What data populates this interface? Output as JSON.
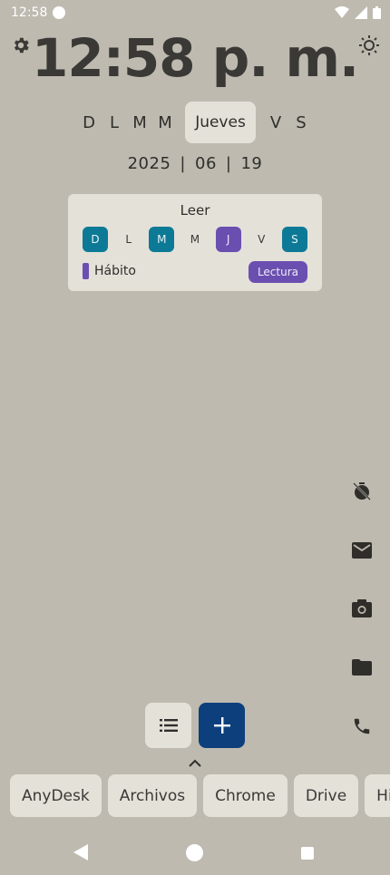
{
  "status_bar": {
    "time": "12:58"
  },
  "clock": "12:58 p. m.",
  "weekdays": {
    "before": [
      "D",
      "L",
      "M",
      "M"
    ],
    "selected": "Jueves",
    "after": [
      "V",
      "S"
    ]
  },
  "date": {
    "year": "2025",
    "month": "06",
    "day": "19",
    "separator": "|"
  },
  "habit_card": {
    "title": "Leer",
    "days": [
      {
        "label": "D",
        "state": "blue"
      },
      {
        "label": "L",
        "state": "none"
      },
      {
        "label": "M",
        "state": "blue"
      },
      {
        "label": "M",
        "state": "none"
      },
      {
        "label": "J",
        "state": "purple"
      },
      {
        "label": "V",
        "state": "none"
      },
      {
        "label": "S",
        "state": "blue"
      }
    ],
    "type_label": "Hábito",
    "tag": "Lectura"
  },
  "side_icons": [
    "timer-off-icon",
    "mail-icon",
    "camera-icon",
    "folder-icon",
    "phone-icon"
  ],
  "apps": [
    "AnyDesk",
    "Archivos",
    "Chrome",
    "Drive",
    "HiP"
  ],
  "colors": {
    "background": "#bebab0",
    "surface": "#e4e1d9",
    "teal": "#0c7a96",
    "purple": "#6a4fb0",
    "navy": "#0d3f7d"
  }
}
